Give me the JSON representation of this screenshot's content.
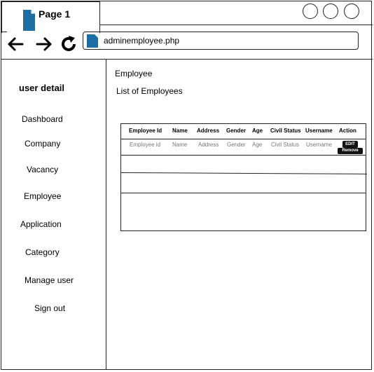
{
  "browser": {
    "tab_title": "Page 1",
    "url": "adminemployee.php"
  },
  "sidebar": {
    "title": "user detail",
    "items": [
      {
        "label": "Dashboard"
      },
      {
        "label": "Company"
      },
      {
        "label": "Vacancy"
      },
      {
        "label": "Employee"
      },
      {
        "label": "Application"
      },
      {
        "label": "Category"
      },
      {
        "label": "Manage user"
      },
      {
        "label": "Sign out"
      }
    ]
  },
  "main": {
    "breadcrumb": "Employee",
    "subtitle": "List of Employees",
    "table": {
      "headers": [
        "Employee Id",
        "Name",
        "Address",
        "Gender",
        "Age",
        "Civil Status",
        "Username",
        "Action"
      ],
      "row": [
        "Employee id",
        "Name",
        "Address",
        "Gender",
        "Age",
        "Civil Status",
        "Username"
      ],
      "edit_label": "EDIT",
      "remove_label": "Remove"
    }
  },
  "colors": {
    "accent": "#1c6ea4",
    "line": "#222222"
  }
}
